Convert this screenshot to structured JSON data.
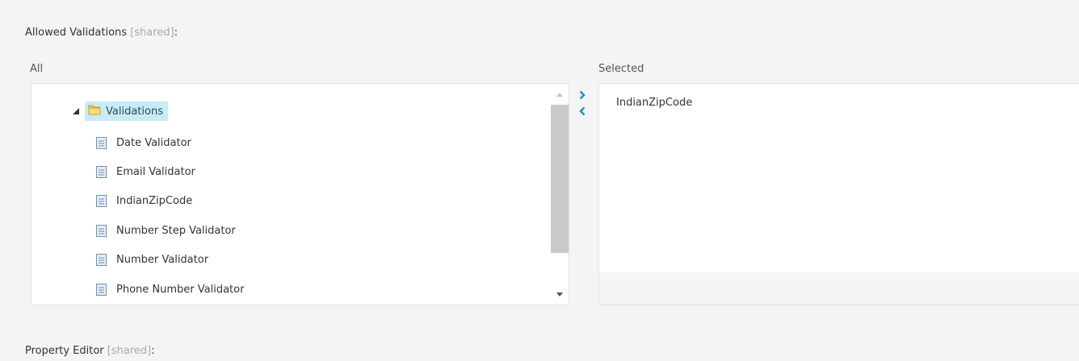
{
  "allowed_validations": {
    "label": "Allowed Validations",
    "shared": "[shared]",
    "colon": ":"
  },
  "all_caption": "All",
  "selected_caption": "Selected",
  "tree": {
    "root_label": "Validations",
    "items": [
      "Date Validator",
      "Email Validator",
      "IndianZipCode",
      "Number Step Validator",
      "Number Validator",
      "Phone Number Validator"
    ]
  },
  "selected": {
    "items": [
      "IndianZipCode"
    ]
  },
  "property_editor": {
    "label": "Property Editor",
    "shared": "[shared]",
    "colon": ":"
  },
  "icons": {
    "expander": "triangle-down-icon",
    "folder": "folder-icon",
    "document": "document-icon",
    "move_right": "chevron-right-icon",
    "move_left": "chevron-left-icon"
  },
  "colors": {
    "accent": "#1b8fc8",
    "selection_bg": "#c8ecf6",
    "folder": "#f2c94c"
  }
}
